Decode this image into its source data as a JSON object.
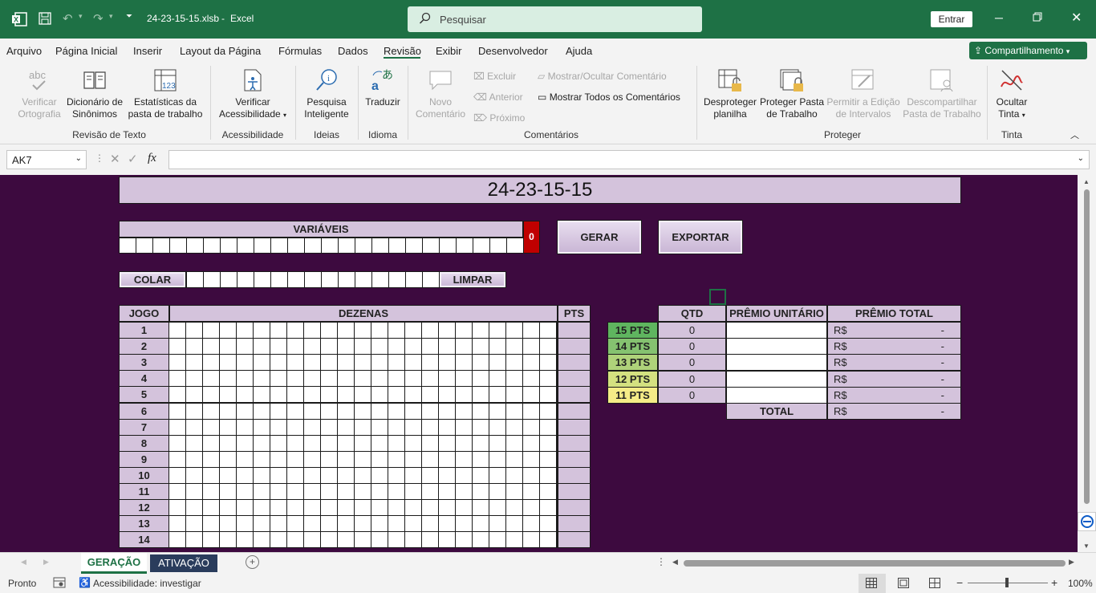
{
  "titlebar": {
    "filename": "24-23-15-15.xlsb",
    "app": "Excel",
    "search_placeholder": "Pesquisar",
    "signin": "Entrar"
  },
  "menu": [
    "Arquivo",
    "Página Inicial",
    "Inserir",
    "Layout da Página",
    "Fórmulas",
    "Dados",
    "Revisão",
    "Exibir",
    "Desenvolvedor",
    "Ajuda"
  ],
  "active_menu": "Revisão",
  "share": "Compartilhamento",
  "ribbon": {
    "verificar_ortografia": [
      "Verificar",
      "Ortografia"
    ],
    "dicionario": [
      "Dicionário de",
      "Sinônimos"
    ],
    "estatisticas": [
      "Estatísticas da",
      "pasta de trabalho"
    ],
    "revisao_group": "Revisão de Texto",
    "verificar_acess": [
      "Verificar",
      "Acessibilidade"
    ],
    "acess_group": "Acessibilidade",
    "pesquisa": [
      "Pesquisa",
      "Inteligente"
    ],
    "ideias_group": "Ideias",
    "traduzir": "Traduzir",
    "idioma_group": "Idioma",
    "novo_comentario": [
      "Novo",
      "Comentário"
    ],
    "excluir": "Excluir",
    "anterior": "Anterior",
    "proximo": "Próximo",
    "mostrar_ocultar": "Mostrar/Ocultar Comentário",
    "mostrar_todos": "Mostrar Todos os Comentários",
    "comentarios_group": "Comentários",
    "desproteger": [
      "Desproteger",
      "planilha"
    ],
    "proteger_pasta": [
      "Proteger Pasta",
      "de Trabalho"
    ],
    "permitir": [
      "Permitir a Edição",
      "de Intervalos"
    ],
    "descompartilhar": [
      "Descompartilhar",
      "Pasta de Trabalho"
    ],
    "proteger_group": "Proteger",
    "ocultar_tinta": [
      "Ocultar",
      "Tinta"
    ],
    "tinta_group": "Tinta"
  },
  "namebox": "AK7",
  "sheet": {
    "title": "24-23-15-15",
    "variaveis": "VARIÁVEIS",
    "counter": "0",
    "gerar": "GERAR",
    "exportar": "EXPORTAR",
    "colar": "COLAR",
    "limpar": "LIMPAR",
    "jogo": "JOGO",
    "dezenas": "DEZENAS",
    "pts": "PTS",
    "games": [
      "1",
      "2",
      "3",
      "4",
      "5",
      "6",
      "7",
      "8",
      "9",
      "10",
      "11",
      "12",
      "13",
      "14"
    ],
    "prize_headers": {
      "qtd": "QTD",
      "unit": "PRÊMIO UNITÁRIO",
      "total": "PRÊMIO TOTAL"
    },
    "prizes": [
      {
        "label": "15 PTS",
        "qtd": "0",
        "currency": "R$",
        "value": "-",
        "color": "#5fb55f"
      },
      {
        "label": "14 PTS",
        "qtd": "0",
        "currency": "R$",
        "value": "-",
        "color": "#85c270"
      },
      {
        "label": "13 PTS",
        "qtd": "0",
        "currency": "R$",
        "value": "-",
        "color": "#afd27a"
      },
      {
        "label": "12 PTS",
        "qtd": "0",
        "currency": "R$",
        "value": "-",
        "color": "#d4e180"
      },
      {
        "label": "11 PTS",
        "qtd": "0",
        "currency": "R$",
        "value": "-",
        "color": "#f5ec87"
      }
    ],
    "total_label": "TOTAL",
    "total_currency": "R$",
    "total_value": "-"
  },
  "tabs": [
    "GERAÇÃO",
    "ATIVAÇÃO"
  ],
  "status": {
    "ready": "Pronto",
    "accessibility": "Acessibilidade: investigar",
    "zoom": "100%"
  }
}
